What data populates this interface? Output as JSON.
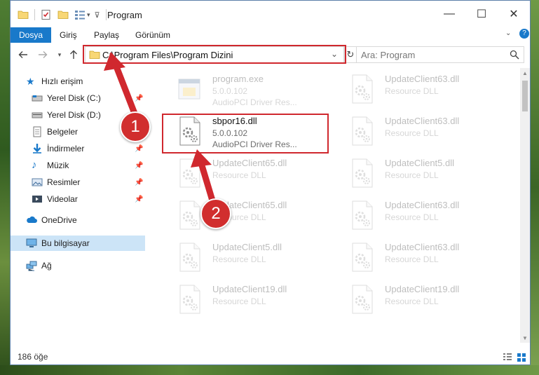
{
  "window": {
    "title": "Program",
    "minimize_glyph": "—",
    "maximize_glyph": "☐",
    "close_glyph": "✕"
  },
  "ribbon": {
    "tabs": [
      {
        "label": "Dosya",
        "active": true
      },
      {
        "label": "Giriş",
        "active": false
      },
      {
        "label": "Paylaş",
        "active": false
      },
      {
        "label": "Görünüm",
        "active": false
      }
    ]
  },
  "address_bar": {
    "path": "C:\\Program Files\\Program Dizini"
  },
  "search": {
    "placeholder": "Ara: Program"
  },
  "sidebar": {
    "items": [
      {
        "label": "Hızlı erişim",
        "icon": "star-icon",
        "pinned": false
      },
      {
        "label": "Yerel Disk (C:)",
        "icon": "drive-icon",
        "pinned": true
      },
      {
        "label": "Yerel Disk (D:)",
        "icon": "drive-icon",
        "pinned": false
      },
      {
        "label": "Belgeler",
        "icon": "documents-icon",
        "pinned": true
      },
      {
        "label": "İndirmeler",
        "icon": "download-icon",
        "pinned": true
      },
      {
        "label": "Müzik",
        "icon": "music-icon",
        "pinned": true
      },
      {
        "label": "Resimler",
        "icon": "pictures-icon",
        "pinned": true
      },
      {
        "label": "Videolar",
        "icon": "videos-icon",
        "pinned": true
      },
      {
        "label": "OneDrive",
        "icon": "cloud-icon",
        "pinned": false
      },
      {
        "label": "Bu bilgisayar",
        "icon": "computer-icon",
        "pinned": false,
        "selected": true
      },
      {
        "label": "Ağ",
        "icon": "network-icon",
        "pinned": false
      }
    ]
  },
  "files": [
    {
      "name": "program.exe",
      "version": "5.0.0.102",
      "description": "AudioPCI Driver Res...",
      "faded": true,
      "icon": "exe-icon"
    },
    {
      "name": "UpdateClient63.dll",
      "version": "",
      "description": "Resource DLL",
      "faded": true,
      "icon": "dll-icon"
    },
    {
      "name": "sbpor16.dll",
      "version": "5.0.0.102",
      "description": "AudioPCI Driver Res...",
      "faded": false,
      "icon": "dll-icon"
    },
    {
      "name": "UpdateClient63.dll",
      "version": "",
      "description": "Resource DLL",
      "faded": true,
      "icon": "dll-icon"
    },
    {
      "name": "UpdateClient65.dll",
      "version": "",
      "description": "Resource DLL",
      "faded": true,
      "icon": "dll-icon"
    },
    {
      "name": "UpdateClient5.dll",
      "version": "",
      "description": "Resource DLL",
      "faded": true,
      "icon": "dll-icon"
    },
    {
      "name": "UpdateClient65.dll",
      "version": "",
      "description": "Resource DLL",
      "faded": true,
      "icon": "dll-icon"
    },
    {
      "name": "UpdateClient63.dll",
      "version": "",
      "description": "Resource DLL",
      "faded": true,
      "icon": "dll-icon"
    },
    {
      "name": "UpdateClient5.dll",
      "version": "",
      "description": "Resource DLL",
      "faded": true,
      "icon": "dll-icon"
    },
    {
      "name": "UpdateClient63.dll",
      "version": "",
      "description": "Resource DLL",
      "faded": true,
      "icon": "dll-icon"
    },
    {
      "name": "UpdateClient19.dll",
      "version": "",
      "description": "Resource DLL",
      "faded": true,
      "icon": "dll-icon"
    },
    {
      "name": "UpdateClient19.dll",
      "version": "",
      "description": "Resource DLL",
      "faded": true,
      "icon": "dll-icon"
    }
  ],
  "status_bar": {
    "item_count": "186 öğe"
  },
  "annotations": {
    "step1": "1",
    "step2": "2",
    "color": "#d0282e"
  }
}
